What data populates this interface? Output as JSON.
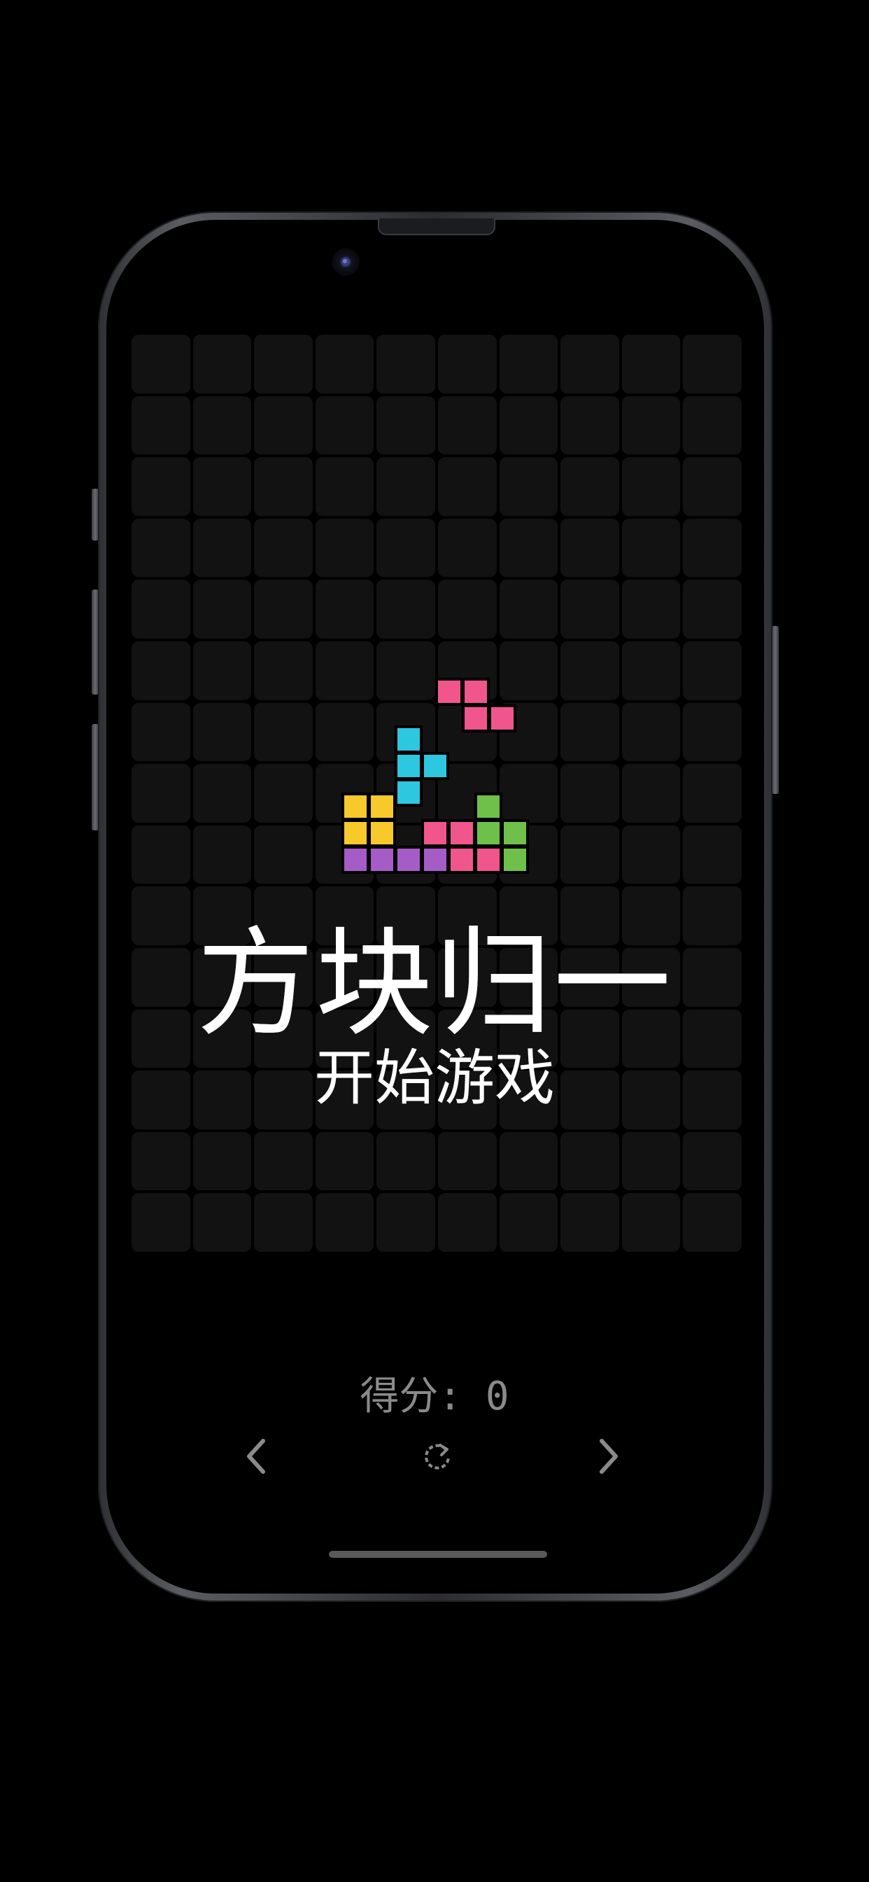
{
  "game": {
    "title": "方块归一",
    "start_label": "开始游戏",
    "score_text": "得分: 0"
  },
  "board": {
    "columns": 10,
    "rows": 15,
    "cell_color": "#121212"
  },
  "colors": {
    "pink": "#f0568c",
    "cyan": "#2ec7e0",
    "yellow": "#f7c92b",
    "green": "#6fc04a",
    "purple": "#a65cc7",
    "title": "#ffffff",
    "score": "#8a8a8a"
  },
  "controls": {
    "prev_icon": "chevron-left-icon",
    "reset_icon": "rotate-icon",
    "next_icon": "chevron-right-icon"
  }
}
